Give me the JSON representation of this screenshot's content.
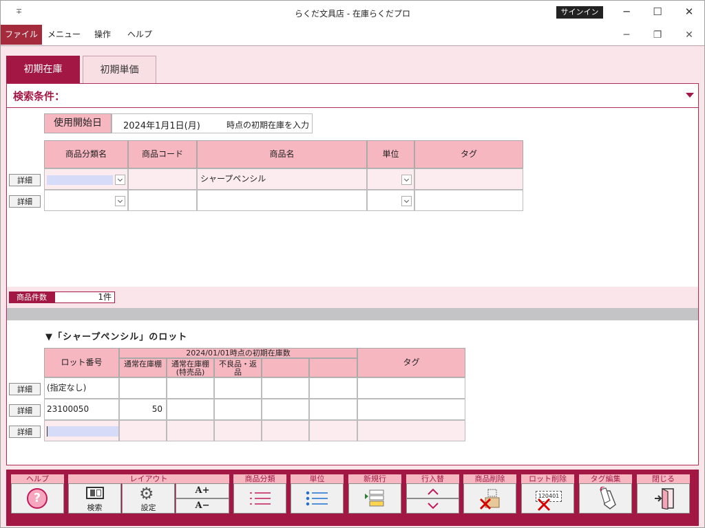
{
  "window": {
    "title": "らくだ文具店 - 在庫らくだプロ",
    "signin": "サインイン",
    "quick_icon": "∓",
    "minimize": "─",
    "maximize": "☐",
    "close": "✕"
  },
  "menu": {
    "file": "ファイル",
    "menu": "メニュー",
    "operation": "操作",
    "help": "ヘルプ"
  },
  "tabs": {
    "initial_stock": "初期在庫",
    "initial_price": "初期単価"
  },
  "search": {
    "title": "検索条件：",
    "start_date_label": "使用開始日",
    "start_date_value": "2024年1月1日(月)",
    "start_date_note": "時点の初期在庫を入力"
  },
  "product_table": {
    "headers": [
      "商品分類名",
      "商品コード",
      "商品名",
      "単位",
      "タグ"
    ],
    "rows": [
      {
        "category": "",
        "code": "",
        "name": "シャープペンシル",
        "unit": "",
        "tag": ""
      },
      {
        "category": "",
        "code": "",
        "name": "",
        "unit": "",
        "tag": ""
      }
    ],
    "detail_label": "詳細"
  },
  "product_count": {
    "label": "商品件数",
    "value": "1件"
  },
  "lot_section": {
    "title": "▼「シャープペンシル」のロット",
    "lot_header": "ロット番号",
    "group_header": "2024/01/01時点の初期在庫数",
    "sub_headers": [
      "通常在庫棚",
      "通常在庫棚\n(特売品)",
      "不良品・返\n品",
      "",
      ""
    ],
    "tag_header": "タグ",
    "rows": [
      {
        "lot": "(指定なし)",
        "qty": [
          "",
          "",
          "",
          "",
          ""
        ],
        "tag": ""
      },
      {
        "lot": "23100050",
        "qty": [
          "50",
          "",
          "",
          "",
          ""
        ],
        "tag": ""
      },
      {
        "lot": "",
        "qty": [
          "",
          "",
          "",
          "",
          ""
        ],
        "tag": ""
      }
    ],
    "detail_label": "詳細"
  },
  "toolbar": {
    "help": "ヘルプ",
    "layout": "レイアウト",
    "search_btn": "検索",
    "settings_btn": "設定",
    "font_up": "A+",
    "font_down": "A−",
    "product_category": "商品分類",
    "unit": "単位",
    "new_row": "新規行",
    "row_swap": "行入替",
    "delete_product": "商品削除",
    "delete_lot": "ロット削除",
    "tag_edit": "タグ編集",
    "close": "閉じる",
    "lot_icon_text": "120401"
  },
  "colors": {
    "accent": "#a31745",
    "header_pink": "#f7b7c1",
    "bg_pink": "#fae6ea"
  }
}
